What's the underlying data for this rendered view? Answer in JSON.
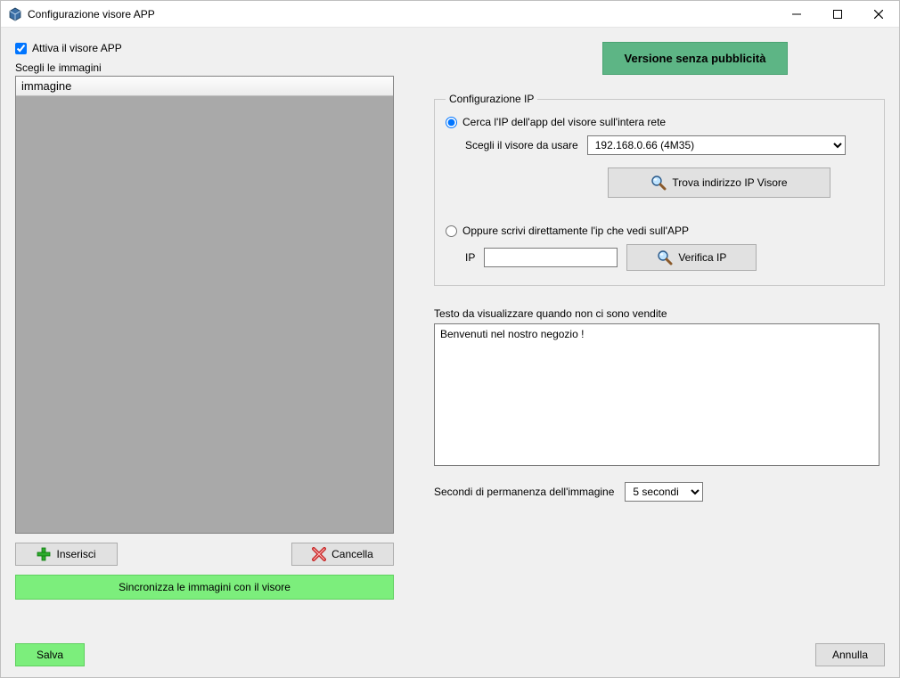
{
  "window": {
    "title": "Configurazione visore APP"
  },
  "activate": {
    "label": "Attiva il visore APP",
    "checked": true
  },
  "images": {
    "label": "Scegli le immagini",
    "header": "immagine",
    "insert_label": "Inserisci",
    "delete_label": "Cancella",
    "sync_label": "Sincronizza le immagini con il visore"
  },
  "banner": {
    "label": "Versione senza pubblicità"
  },
  "ip": {
    "legend": "Configurazione IP",
    "search_label": "Cerca l'IP dell'app del visore sull'intera rete",
    "choose_label": "Scegli il visore da usare",
    "selected": "192.168.0.66 (4M35)",
    "find_label": "Trova indirizzo IP Visore",
    "direct_label": "Oppure scrivi direttamente l'ip che vedi sull'APP",
    "ip_field_label": "IP",
    "ip_value": "",
    "verify_label": "Verifica IP"
  },
  "idle_text": {
    "label": "Testo da visualizzare quando non ci sono vendite",
    "value": "Benvenuti nel nostro negozio !"
  },
  "seconds": {
    "label": "Secondi di permanenza dell'immagine",
    "value": "5 secondi"
  },
  "footer": {
    "save_label": "Salva",
    "cancel_label": "Annulla"
  }
}
